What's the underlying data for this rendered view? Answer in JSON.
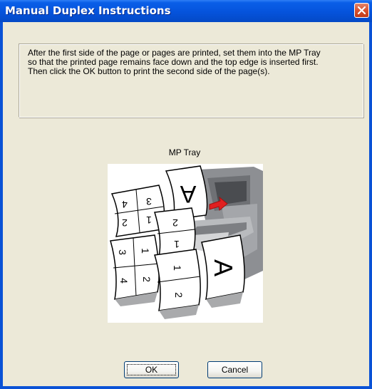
{
  "window": {
    "title": "Manual Duplex Instructions",
    "close_icon": "close-icon"
  },
  "instructions": {
    "line1": "After the first side of the page or pages are printed, set them into the MP Tray",
    "line2": "so that the printed page remains face down and the top edge is inserted first.",
    "line3": "Then click the OK button to print the second side of the page(s)."
  },
  "figure": {
    "label": "MP Tray",
    "page_letter": "A",
    "page_numbers": [
      "1",
      "2",
      "3",
      "4"
    ]
  },
  "buttons": {
    "ok": "OK",
    "cancel": "Cancel"
  },
  "colors": {
    "titlebar": "#0553dc",
    "dialog_bg": "#ece9d8",
    "close_button": "#d9512e",
    "arrow": "#e02020"
  }
}
